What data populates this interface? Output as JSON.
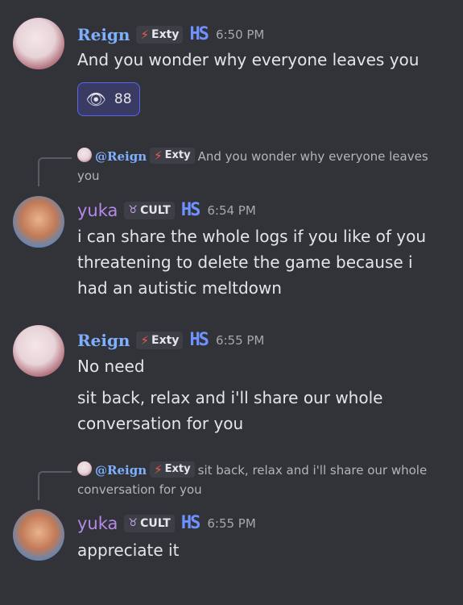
{
  "messages": [
    {
      "author": "Reign",
      "role_tag": "Exty",
      "badge": "HS",
      "time": "6:50 PM",
      "lines": [
        "And you wonder why everyone leaves you"
      ],
      "reaction": {
        "icon": "eye-icon",
        "count": "88"
      }
    },
    {
      "reply_to": {
        "mention": "@Reign",
        "role_tag": "Exty",
        "text": "And you wonder why everyone leaves you"
      },
      "author": "yuka",
      "role_tag": "CULT",
      "badge": "HS",
      "time": "6:54 PM",
      "lines": [
        "i can share the whole logs if you like of you threatening to delete the game because i had an autistic meltdown"
      ]
    },
    {
      "author": "Reign",
      "role_tag": "Exty",
      "badge": "HS",
      "time": "6:55 PM",
      "lines": [
        "No need",
        "sit back, relax and i'll share our whole conversation for you"
      ]
    },
    {
      "reply_to": {
        "mention": "@Reign",
        "role_tag": "Exty",
        "text": "sit back, relax and i'll share our whole conversation for you"
      },
      "author": "yuka",
      "role_tag": "CULT",
      "badge": "HS",
      "time": "6:55 PM",
      "lines": [
        "appreciate it"
      ]
    }
  ],
  "colors": {
    "background": "#323339",
    "reign_name": "#7fb0ff",
    "yuka_name": "#b58ae6",
    "reaction_border": "#5865f2",
    "badge": "#6e92ff"
  }
}
